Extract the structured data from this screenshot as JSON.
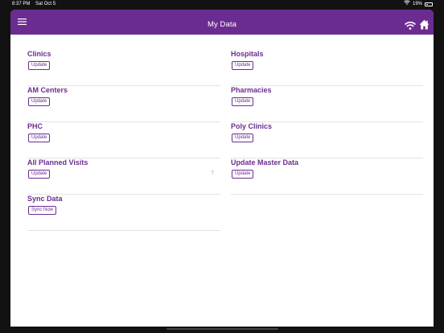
{
  "status_bar": {
    "time": "8:37 PM",
    "date": "Sat Oct 5",
    "battery": "19%",
    "icons": [
      "wifi-icon",
      "battery-icon"
    ]
  },
  "header": {
    "title": "My Data",
    "menu_icon": "menu-icon",
    "wifi_icon": "wifi-icon",
    "home_icon": "home-icon"
  },
  "colors": {
    "brand": "#6b2c91",
    "divider": "#e4e4e4"
  },
  "left_items": [
    {
      "title": "Clinics",
      "button": "Update",
      "count": ""
    },
    {
      "title": "AM Centers",
      "button": "Update",
      "count": ""
    },
    {
      "title": "PHC",
      "button": "Update",
      "count": ""
    },
    {
      "title": "All Planned Visits",
      "button": "Update",
      "count": "7"
    },
    {
      "title": "Sync Data",
      "button": "Sync Now",
      "count": ""
    }
  ],
  "right_items": [
    {
      "title": "Hospitals",
      "button": "Update"
    },
    {
      "title": "Pharmacies",
      "button": "Update"
    },
    {
      "title": "Poly Clinics",
      "button": "Update"
    },
    {
      "title": "Update Master Data",
      "button": "Update"
    }
  ]
}
